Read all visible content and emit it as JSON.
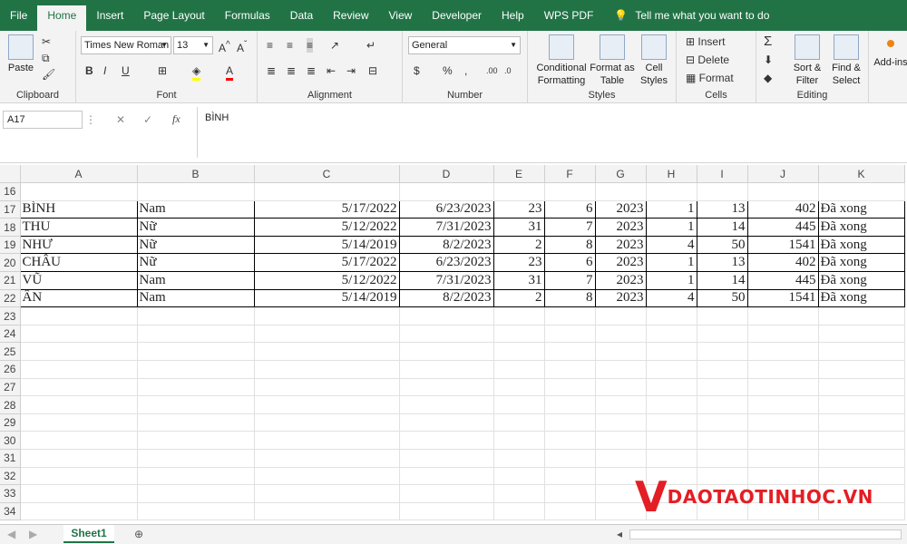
{
  "menu": {
    "tabs": [
      "File",
      "Home",
      "Insert",
      "Page Layout",
      "Formulas",
      "Data",
      "Review",
      "View",
      "Developer",
      "Help",
      "WPS PDF"
    ],
    "active": "Home",
    "tell_me": "Tell me what you want to do"
  },
  "ribbon": {
    "clipboard": {
      "paste": "Paste",
      "label": "Clipboard"
    },
    "font": {
      "name": "Times New Roman",
      "size": "13",
      "label": "Font"
    },
    "alignment": {
      "label": "Alignment"
    },
    "number": {
      "format": "General",
      "label": "Number"
    },
    "styles": {
      "conditional": "Conditional Formatting",
      "format_table": "Format as Table",
      "cell_styles": "Cell Styles",
      "label": "Styles"
    },
    "cells": {
      "insert": "Insert",
      "delete": "Delete",
      "format": "Format",
      "label": "Cells"
    },
    "editing": {
      "sort": "Sort & Filter",
      "find": "Find & Select",
      "label": "Editing"
    },
    "addins": {
      "label": "Add-ins"
    }
  },
  "formula_bar": {
    "name_box": "A17",
    "value": "BÌNH"
  },
  "sheet": {
    "columns": [
      "A",
      "B",
      "C",
      "D",
      "E",
      "F",
      "G",
      "H",
      "I",
      "J",
      "K"
    ],
    "rows": [
      {
        "n": "16",
        "cells": [
          "",
          "",
          "",
          "",
          "",
          "",
          "",
          "",
          "",
          "",
          ""
        ]
      },
      {
        "n": "17",
        "cells": [
          "BÌNH",
          "Nam",
          "5/17/2022",
          "6/23/2023",
          "23",
          "6",
          "2023",
          "1",
          "13",
          "402",
          "Đã xong"
        ]
      },
      {
        "n": "18",
        "cells": [
          "THU",
          "Nữ",
          "5/12/2022",
          "7/31/2023",
          "31",
          "7",
          "2023",
          "1",
          "14",
          "445",
          "Đã xong"
        ]
      },
      {
        "n": "19",
        "cells": [
          "NHƯ",
          "Nữ",
          "5/14/2019",
          "8/2/2023",
          "2",
          "8",
          "2023",
          "4",
          "50",
          "1541",
          "Đã xong"
        ]
      },
      {
        "n": "20",
        "cells": [
          "CHÂU",
          "Nữ",
          "5/17/2022",
          "6/23/2023",
          "23",
          "6",
          "2023",
          "1",
          "13",
          "402",
          "Đã xong"
        ]
      },
      {
        "n": "21",
        "cells": [
          "VŨ",
          "Nam",
          "5/12/2022",
          "7/31/2023",
          "31",
          "7",
          "2023",
          "1",
          "14",
          "445",
          "Đã xong"
        ]
      },
      {
        "n": "22",
        "cells": [
          "ÂN",
          "Nam",
          "5/14/2019",
          "8/2/2023",
          "2",
          "8",
          "2023",
          "4",
          "50",
          "1541",
          "Đã xong"
        ]
      },
      {
        "n": "23",
        "cells": [
          "",
          "",
          "",
          "",
          "",
          "",
          "",
          "",
          "",
          "",
          ""
        ]
      },
      {
        "n": "24",
        "cells": [
          "",
          "",
          "",
          "",
          "",
          "",
          "",
          "",
          "",
          "",
          ""
        ]
      },
      {
        "n": "25",
        "cells": [
          "",
          "",
          "",
          "",
          "",
          "",
          "",
          "",
          "",
          "",
          ""
        ]
      },
      {
        "n": "26",
        "cells": [
          "",
          "",
          "",
          "",
          "",
          "",
          "",
          "",
          "",
          "",
          ""
        ]
      },
      {
        "n": "27",
        "cells": [
          "",
          "",
          "",
          "",
          "",
          "",
          "",
          "",
          "",
          "",
          ""
        ]
      },
      {
        "n": "28",
        "cells": [
          "",
          "",
          "",
          "",
          "",
          "",
          "",
          "",
          "",
          "",
          ""
        ]
      },
      {
        "n": "29",
        "cells": [
          "",
          "",
          "",
          "",
          "",
          "",
          "",
          "",
          "",
          "",
          ""
        ]
      },
      {
        "n": "30",
        "cells": [
          "",
          "",
          "",
          "",
          "",
          "",
          "",
          "",
          "",
          "",
          ""
        ]
      },
      {
        "n": "31",
        "cells": [
          "",
          "",
          "",
          "",
          "",
          "",
          "",
          "",
          "",
          "",
          ""
        ]
      },
      {
        "n": "32",
        "cells": [
          "",
          "",
          "",
          "",
          "",
          "",
          "",
          "",
          "",
          "",
          ""
        ]
      },
      {
        "n": "33",
        "cells": [
          "",
          "",
          "",
          "",
          "",
          "",
          "",
          "",
          "",
          "",
          ""
        ]
      },
      {
        "n": "34",
        "cells": [
          "",
          "",
          "",
          "",
          "",
          "",
          "",
          "",
          "",
          "",
          ""
        ]
      }
    ]
  },
  "sheet_tab": "Sheet1",
  "watermark": {
    "text": "DAOTAOTINHOC.VN",
    "color": "#e31e24"
  },
  "colors": {
    "accent": "#217346"
  }
}
